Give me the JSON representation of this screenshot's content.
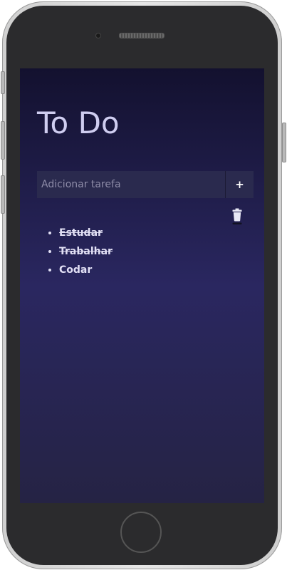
{
  "app": {
    "title": "To Do"
  },
  "form": {
    "input_value": "",
    "input_placeholder": "Adicionar tarefa",
    "add_button_label": "+"
  },
  "tasks": [
    {
      "text": "Estudar",
      "done": true
    },
    {
      "text": "Trabalhar",
      "done": true
    },
    {
      "text": "Codar",
      "done": false
    }
  ],
  "icons": {
    "delete": "trash-icon"
  },
  "colors": {
    "background_top": "#13112f",
    "background_mid": "#2a2760",
    "background_bottom": "#252344",
    "input_background": "#2a2a4e",
    "title_text": "#cfcdf0",
    "task_text": "#e2e0f5"
  }
}
